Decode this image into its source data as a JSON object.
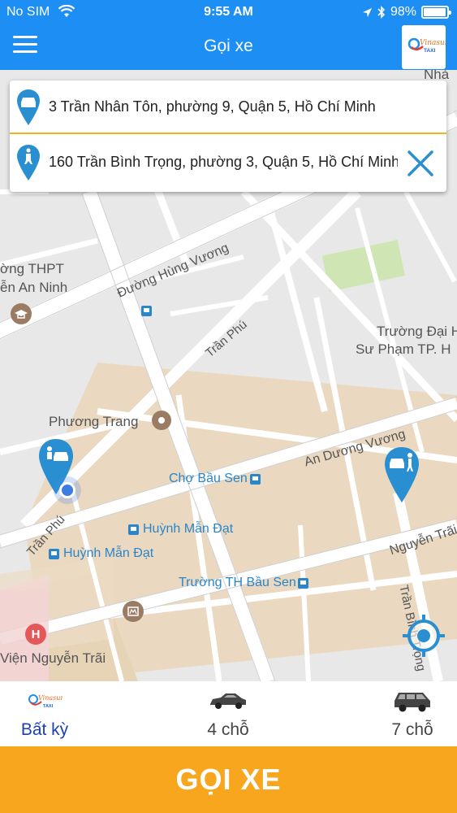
{
  "status": {
    "carrier": "No SIM",
    "time": "9:55 AM",
    "battery": "98%",
    "battery_level": 0.98
  },
  "header": {
    "title": "Gọi xe",
    "logo_text": "TAXI",
    "logo_script": "Vinasun"
  },
  "address": {
    "from": "3 Trần Nhân Tôn, phường 9, Quận 5, Hồ Chí Minh",
    "to": "160 Trần Bình Trọng, phường 3, Quận 5, Hồ Chí Minh"
  },
  "map_labels": {
    "school": [
      "ờng THPT",
      "ễn An Ninh"
    ],
    "street_hung_vuong": "Đường Hùng Vương",
    "street_tran_phu_1": "Trần Phú",
    "street_tran_phu_2": "Trần Phú",
    "university": [
      "Trường Đại H",
      "Sư Phạm TP. H"
    ],
    "phuong_trang": "Phương Trang",
    "an_duong_vuong": "An Dương Vương",
    "cho_bau_sen": "Chợ Bầu Sen",
    "huynh_man_dat_1": "Huỳnh Mẫn Đạt",
    "huynh_man_dat_2": "Huỳnh Mẫn Đạt",
    "nguyen_trai": "Nguyễn Trãi",
    "truong_th_bau_sen": "Trường TH Bầu Sen",
    "hospital": "Viện Nguyễn Trãi",
    "tran_binh_trong": "Trần Bình Trọng",
    "top_right": "Nhà"
  },
  "car_options": [
    {
      "label": "Bất kỳ",
      "icon": "taxi-logo-icon",
      "active": true
    },
    {
      "label": "4 chỗ",
      "icon": "sedan-icon",
      "active": false
    },
    {
      "label": "7 chỗ",
      "icon": "suv-icon",
      "active": false
    }
  ],
  "action": {
    "call_label": "GỌI XE"
  },
  "colors": {
    "primary": "#1d8ef3",
    "accent": "#f8a61e",
    "active_option": "#1c3fb6",
    "divider": "#f3b21b"
  }
}
